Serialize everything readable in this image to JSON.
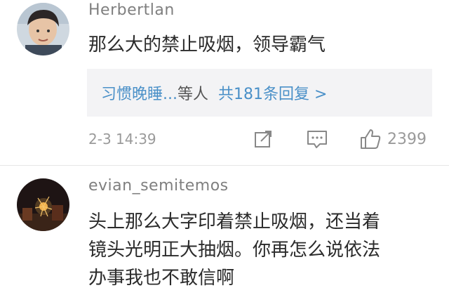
{
  "comments": [
    {
      "username": "Herbertlan",
      "text": "那么大的禁止吸烟，领导霸气",
      "replies": {
        "names": "习惯晚睡...",
        "suffix": "等人",
        "count": "共181条回复 >"
      },
      "time": "2-3 14:39",
      "likes": "2399"
    },
    {
      "username": "evian_semitemos",
      "lines": [
        "头上那么大字印着禁止吸烟，还当着",
        "镜头光明正大抽烟。你再怎么说依法",
        "办事我也不敢信啊"
      ]
    }
  ],
  "icons": [
    "share-icon",
    "comment-reply-icon",
    "thumbs-up-icon"
  ],
  "colors": {
    "link": "#4a90c8",
    "meta": "#9a9a9a",
    "reply_bg": "#f3f3f5"
  }
}
